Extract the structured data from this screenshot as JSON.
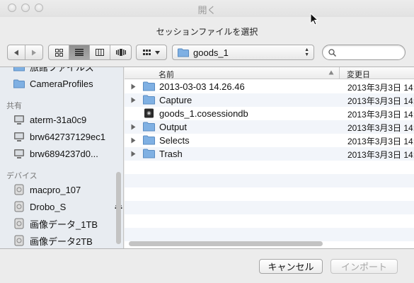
{
  "window": {
    "title": "開く",
    "prompt": "セッションファイルを選択"
  },
  "toolbar": {
    "back_icon": "back-arrow-icon",
    "forward_icon": "forward-arrow-icon",
    "view_modes": [
      "icon-view",
      "list-view",
      "column-view",
      "coverflow-view"
    ],
    "active_view": "list-view",
    "location": "goods_1",
    "search_value": "",
    "search_placeholder": ""
  },
  "sidebar": {
    "partial_top_item": "旅館ファイルズ",
    "items_top": [
      {
        "label": "CameraProfiles",
        "icon": "folder-icon"
      }
    ],
    "shared_header": "共有",
    "shared": [
      {
        "label": "aterm-31a0c9",
        "icon": "computer-icon"
      },
      {
        "label": "brw642737129ec1",
        "icon": "computer-icon"
      },
      {
        "label": "brw6894237d0...",
        "icon": "computer-icon"
      }
    ],
    "devices_header": "デバイス",
    "devices": [
      {
        "label": "macpro_107",
        "icon": "hard-drive-icon"
      },
      {
        "label": "Drobo_S",
        "icon": "hard-drive-icon",
        "ejectable": true
      },
      {
        "label": "画像データ_1TB",
        "icon": "hard-drive-icon"
      },
      {
        "label": "画像データ2TB",
        "icon": "hard-drive-icon"
      }
    ]
  },
  "filelist": {
    "columns": {
      "name": "名前",
      "modified": "変更日"
    },
    "rows": [
      {
        "name": "2013-03-03 14.26.46",
        "kind": "folder",
        "date": "2013年3月3日 14:"
      },
      {
        "name": "Capture",
        "kind": "folder",
        "date": "2013年3月3日 14:"
      },
      {
        "name": "goods_1.cosessiondb",
        "kind": "document",
        "date": "2013年3月3日 14:"
      },
      {
        "name": "Output",
        "kind": "folder",
        "date": "2013年3月3日 14:"
      },
      {
        "name": "Selects",
        "kind": "folder",
        "date": "2013年3月3日 14:"
      },
      {
        "name": "Trash",
        "kind": "folder",
        "date": "2013年3月3日 14:"
      }
    ]
  },
  "buttons": {
    "cancel": "キャンセル",
    "import": "インポート"
  },
  "colors": {
    "folder_blue": "#7fb0e3",
    "sidebar_bg": "#e8ecf1",
    "row_alt": "#f2f5fa"
  }
}
